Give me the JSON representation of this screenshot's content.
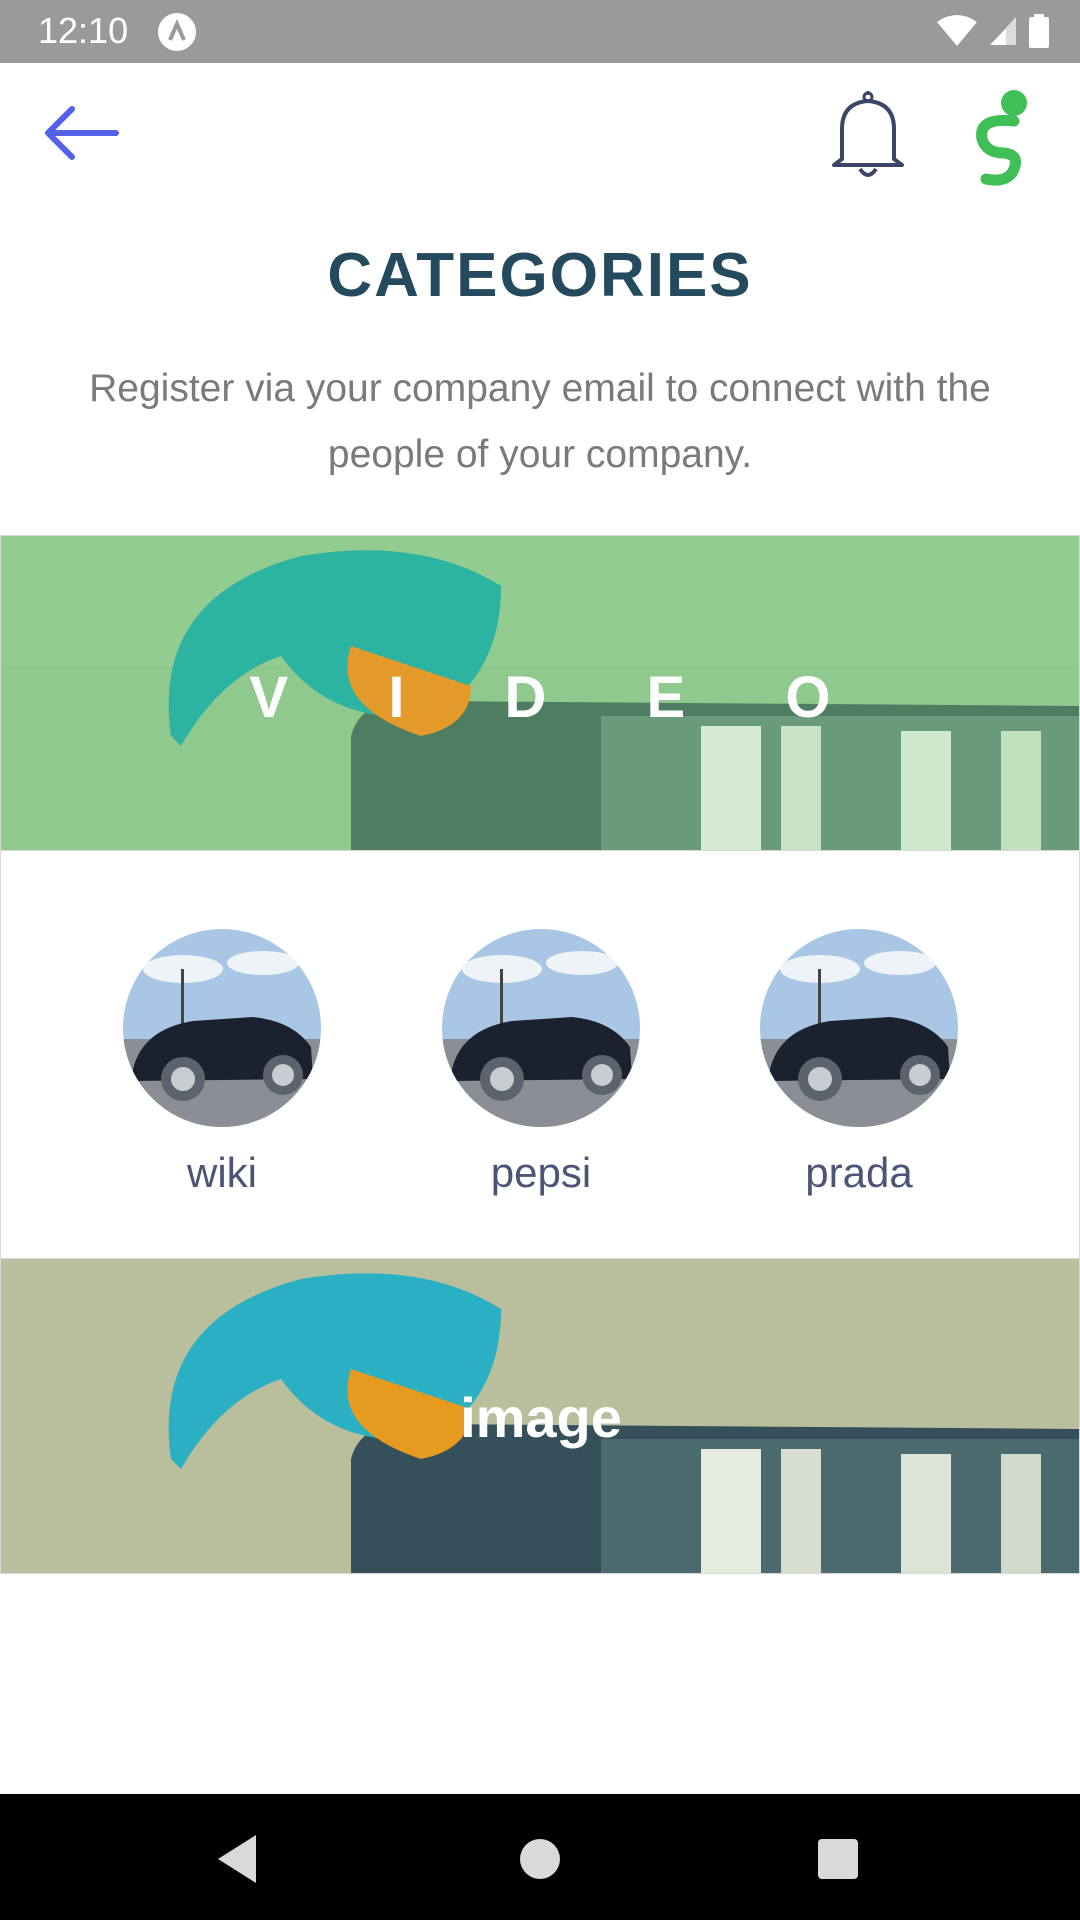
{
  "status_bar": {
    "time": "12:10"
  },
  "header": {
    "back_label": "",
    "title": "CATEGORIES",
    "subtitle": "Register via your company email to connect with the people of your company."
  },
  "categories": [
    {
      "label": "V I D E O"
    },
    {
      "label": "image"
    }
  ],
  "subcategories": [
    {
      "label": "wiki"
    },
    {
      "label": "pepsi"
    },
    {
      "label": "prada"
    }
  ],
  "colors": {
    "title": "#264a5d",
    "accent": "#5561e8",
    "logo": "#3fbf56",
    "sub_label": "#4d5577"
  }
}
